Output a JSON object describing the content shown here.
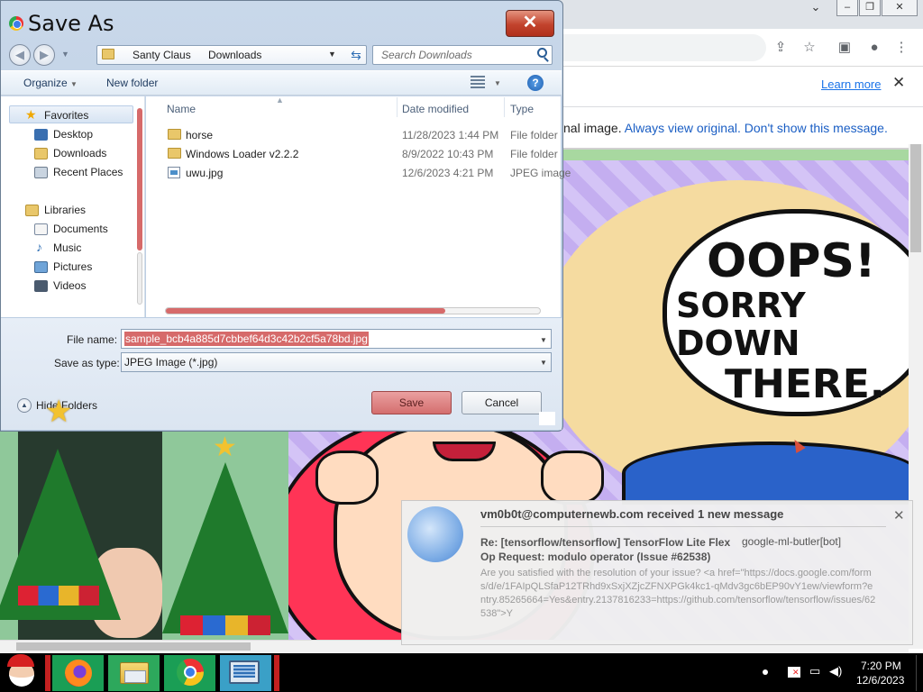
{
  "browser": {
    "infobar": {
      "learn_more": "Learn more"
    },
    "notice": {
      "prefix": "nal image. ",
      "link1": "Always view original.",
      "link2": "Don't show this message."
    },
    "comic": {
      "line1": "OOPS!",
      "line2": "SORRY DOWN",
      "line3": "THERE."
    }
  },
  "dialog": {
    "title": "Save As",
    "address": {
      "crumbs": [
        "Santy Claus",
        "Downloads"
      ]
    },
    "search": {
      "placeholder": "Search Downloads"
    },
    "commands": {
      "organize": "Organize",
      "new_folder": "New folder"
    },
    "nav": {
      "favorites": "Favorites",
      "items": [
        "Desktop",
        "Downloads",
        "Recent Places"
      ],
      "libraries": "Libraries",
      "library_items": [
        "Documents",
        "Music",
        "Pictures",
        "Videos"
      ]
    },
    "columns": {
      "name": "Name",
      "date": "Date modified",
      "type": "Type"
    },
    "files": [
      {
        "name": "horse",
        "date": "11/28/2023 1:44 PM",
        "type": "File folder",
        "icon": "folder-icon"
      },
      {
        "name": "Windows Loader v2.2.2",
        "date": "8/9/2022 10:43 PM",
        "type": "File folder",
        "icon": "folder-icon"
      },
      {
        "name": "uwu.jpg",
        "date": "12/6/2023 4:21 PM",
        "type": "JPEG image",
        "icon": "image-file-icon"
      }
    ],
    "file_name_label": "File name:",
    "file_name_value": "sample_bcb4a885d7cbbef64d3c42b2cf5a78bd.jpg",
    "save_as_type_label": "Save as type:",
    "save_as_type_value": "JPEG Image (*.jpg)",
    "hide_folders": "Hide Folders",
    "save_label": "Save",
    "cancel_label": "Cancel"
  },
  "notification": {
    "title": "vm0b0t@computernewb.com received 1 new message",
    "subject": "Re: [tensorflow/tensorflow] TensorFlow Lite Flex Op Request: modulo operator (Issue #62538)",
    "from": "google-ml-butler[bot]",
    "body": "Are you satisfied with the resolution of your issue? <a href=\"https://docs.google.com/forms/d/e/1FAIpQLSfaP12TRhd9xSxjXZjcZFNXPGk4kc1-qMdv3gc6bEP90vY1ew/viewform?entry.85265664=Yes&entry.2137816233=https://github.com/tensorflow/tensorflow/issues/62538\">Y"
  },
  "taskbar": {
    "clock_time": "7:20 PM",
    "clock_date": "12/6/2023"
  },
  "colors": {
    "accent_red": "#d66a6a",
    "link_blue": "#1a73e8",
    "taskbar": "#000000"
  }
}
